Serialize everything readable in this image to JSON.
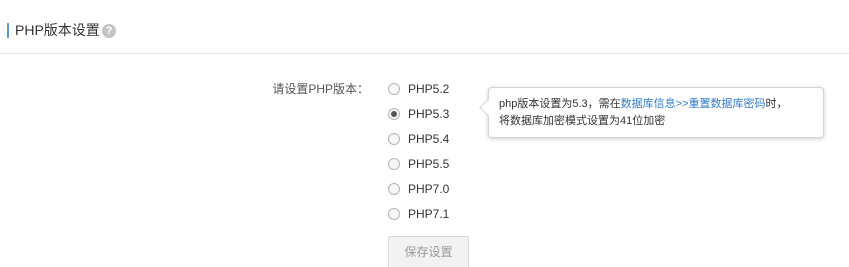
{
  "header": {
    "title": "PHP版本设置",
    "help_icon": "question-circle-icon",
    "help_glyph": "?"
  },
  "form": {
    "label": "请设置PHP版本：",
    "options": [
      {
        "label": "PHP5.2",
        "checked": false
      },
      {
        "label": "PHP5.3",
        "checked": true
      },
      {
        "label": "PHP5.4",
        "checked": false
      },
      {
        "label": "PHP5.5",
        "checked": false
      },
      {
        "label": "PHP7.0",
        "checked": false
      },
      {
        "label": "PHP7.1",
        "checked": false
      }
    ],
    "save_label": "保存设置"
  },
  "tooltip": {
    "line1_prefix": "php版本设置为5.3，需在",
    "link": "数据库信息>>重置数据库密码",
    "line1_suffix": "时，",
    "line2": "将数据库加密模式设置为41位加密"
  },
  "colors": {
    "accent": "#5b9bd5",
    "link": "#2f7dc9",
    "border": "#e6e6e6"
  }
}
